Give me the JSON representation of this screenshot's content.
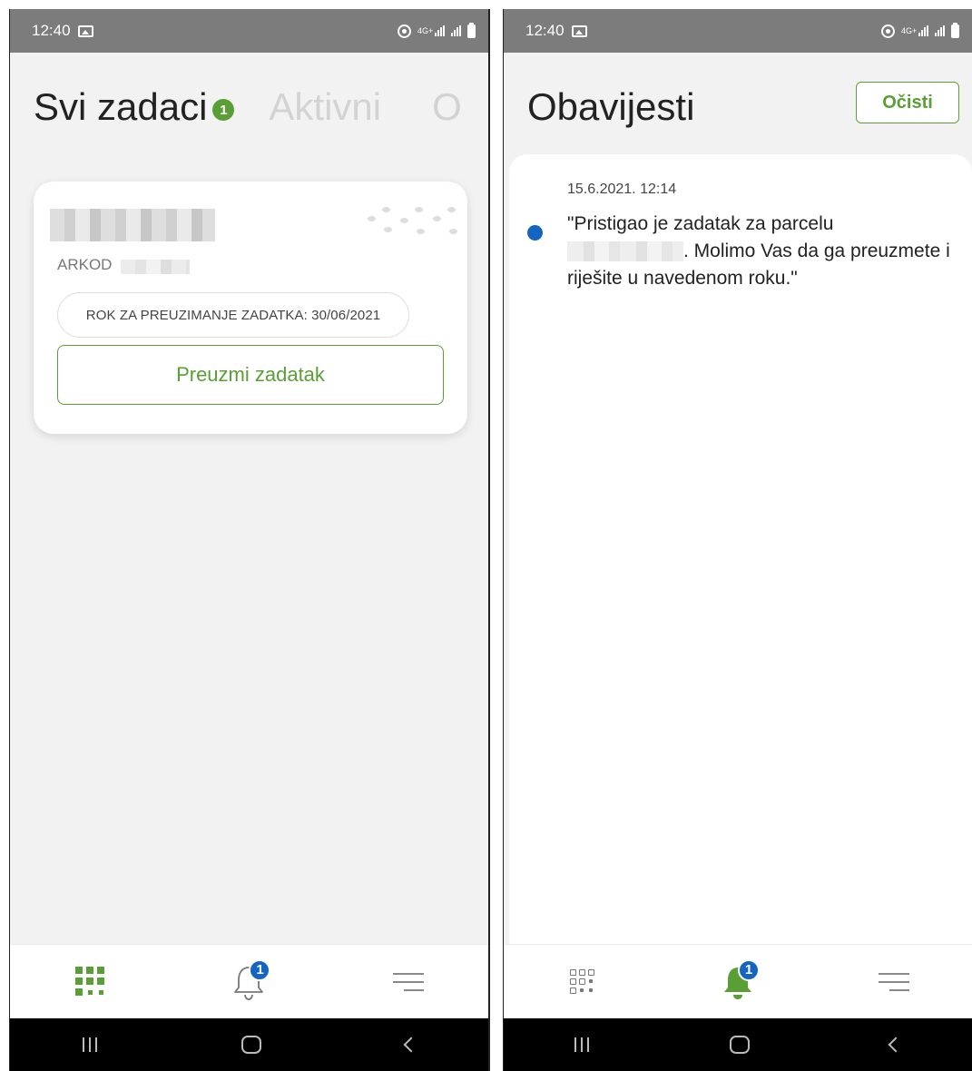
{
  "status_bar": {
    "time": "12:40",
    "network": "4G+"
  },
  "tasks_screen": {
    "tabs": [
      {
        "label": "Svi zadaci",
        "count": "1"
      },
      {
        "label": "Aktivni"
      },
      {
        "label": "O"
      }
    ],
    "task_card": {
      "arkod_label": "ARKOD",
      "deadline": "ROK ZA PREUZIMANJE ZADATKA: 30/06/2021",
      "accept_label": "Preuzmi zadatak"
    }
  },
  "notifications_screen": {
    "title": "Obavijesti",
    "clear_label": "Očisti",
    "items": [
      {
        "date": "15.6.2021. 12:14",
        "text_before": "\"Pristigao je zadatak za parcelu",
        "text_after": ". Molimo Vas da ga preuzmete i riješite u navedenom roku.\"",
        "unread": true
      }
    ]
  },
  "bottom_nav": {
    "notification_badge": "1",
    "items": [
      "tasks-grid-icon",
      "bell-icon",
      "menu-icon"
    ]
  },
  "colors": {
    "accent_green": "#5a9f36",
    "badge_blue": "#1565c0",
    "status_bar": "#7c7c7c"
  }
}
